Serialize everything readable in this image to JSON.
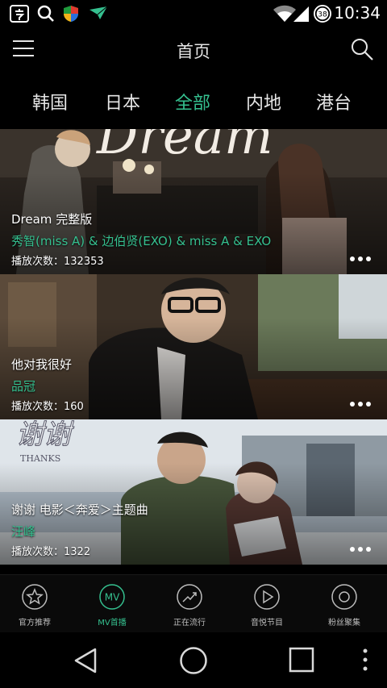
{
  "status_bar": {
    "time": "10:34",
    "battery_level": "38",
    "icons": [
      "input-method-icon",
      "search-icon",
      "shield-icon",
      "plane-icon",
      "wifi-icon",
      "signal-icon",
      "battery-icon"
    ]
  },
  "header": {
    "title": "首页",
    "menu_icon": "menu-icon",
    "search_icon": "search-icon"
  },
  "tabs": [
    {
      "label": "韩国",
      "active": false
    },
    {
      "label": "日本",
      "active": false
    },
    {
      "label": "全部",
      "active": true
    },
    {
      "label": "内地",
      "active": false
    },
    {
      "label": "港台",
      "active": false
    }
  ],
  "cards": [
    {
      "title": "Dream 完整版",
      "artist": "秀智(miss A) & 边伯贤(EXO) & miss A & EXO",
      "plays": "播放次数：132353"
    },
    {
      "title": "他对我很好",
      "artist": "品冠",
      "plays": "播放次数：160"
    },
    {
      "title": "谢谢 电影＜奔爱＞主题曲",
      "artist": "汪峰",
      "plays": "播放次数：1322"
    }
  ],
  "bottom_nav": [
    {
      "label": "官方推荐",
      "icon": "star-icon",
      "active": false
    },
    {
      "label": "MV首播",
      "icon": "mv-icon",
      "icon_text": "MV",
      "active": true
    },
    {
      "label": "正在流行",
      "icon": "trend-icon",
      "active": false
    },
    {
      "label": "音悦节目",
      "icon": "play-icon",
      "active": false
    },
    {
      "label": "粉丝聚集",
      "icon": "disc-icon",
      "active": false
    }
  ],
  "colors": {
    "accent": "#35c08f",
    "background": "#000000"
  }
}
